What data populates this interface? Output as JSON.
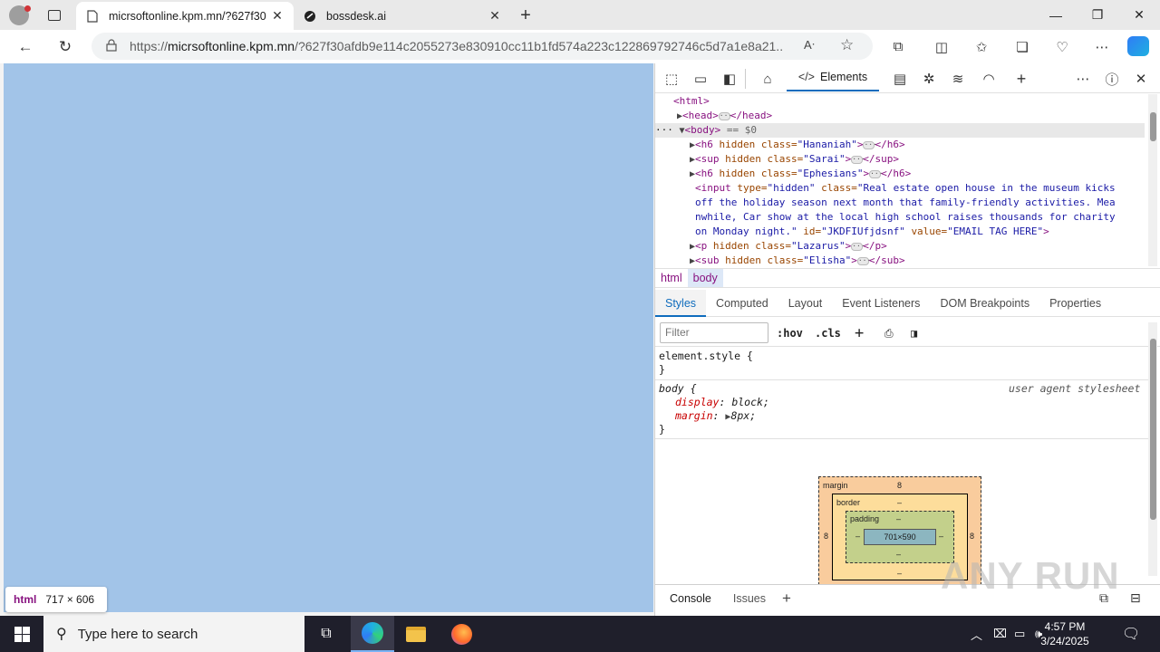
{
  "browser": {
    "tabs": [
      {
        "title": "micrsoftonline.kpm.mn/?627f30",
        "active": true
      },
      {
        "title": "bossdesk.ai",
        "active": false
      }
    ],
    "address": {
      "prefix": "https://",
      "host": "micrsoftonline.kpm.mn",
      "path": "/?627f30afdb9e114c2055273e830910cc11b1fd574a223c122869792746c5d7a1e8a21..."
    },
    "tooltip": {
      "tag": "html",
      "size": "717 × 606"
    }
  },
  "devtools": {
    "main_tab": "Elements",
    "dom_lines": {
      "html_open": "<html>",
      "head_tag": "<head>",
      "head_close": "</head>",
      "body_tag": "<body>",
      "body_eq": "== $0",
      "l1_tag": "<h6 ",
      "l1_attr": "hidden class=",
      "l1_val": "\"Hananiah\"",
      "l1_close": "</h6>",
      "l2_tag": "<sup ",
      "l2_attr": "hidden class=",
      "l2_val": "\"Sarai\"",
      "l2_close": "</sup>",
      "l3_tag": "<h6 ",
      "l3_attr": "hidden class=",
      "l3_val": "\"Ephesians\"",
      "l3_close": "</h6>",
      "input_tag": "<input ",
      "input_a1": "type=",
      "input_v1": "\"hidden\" ",
      "input_a2": "class=",
      "input_v2a": "\"Real estate open house in the museum kicks",
      "input_v2b": "off the holiday season next month that family-friendly activities. Mea",
      "input_v2c": "nwhile, Car show at the local high school raises thousands for charity",
      "input_v2d": "on Monday night.\" ",
      "input_a3": "id=",
      "input_v3": "\"JKDFIUfjdsnf\" ",
      "input_a4": "value=",
      "input_v4": "\"EMAIL TAG HERE\"",
      "input_end": ">",
      "l5_tag": "<p ",
      "l5_attr": "hidden class=",
      "l5_val": "\"Lazarus\"",
      "l5_close": "</p>",
      "l6_tag": "<sub ",
      "l6_attr": "hidden class=",
      "l6_val": "\"Elisha\"",
      "l6_close": "</sub>"
    },
    "breadcrumbs": [
      "html",
      "body"
    ],
    "sub_tabs": [
      "Styles",
      "Computed",
      "Layout",
      "Event Listeners",
      "DOM Breakpoints",
      "Properties"
    ],
    "filter_placeholder": "Filter",
    "hov": ":hov",
    "cls": ".cls",
    "styles": {
      "element_style": "element.style {",
      "close_brace": "}",
      "body_selector": "body {",
      "ua_label": "user agent stylesheet",
      "display_prop": "display",
      "display_val": "block;",
      "margin_prop": "margin",
      "margin_val": "8px;"
    },
    "box_model": {
      "margin_label": "margin",
      "margin_value": "8",
      "border_label": "border",
      "border_value": "–",
      "padding_label": "padding",
      "padding_value": "–",
      "content_size": "701×590",
      "side_margin": "8",
      "dash": "–"
    },
    "drawer_tabs": [
      "Console",
      "Issues"
    ]
  },
  "taskbar": {
    "search_placeholder": "Type here to search",
    "time": "4:57 PM",
    "date": "3/24/2025"
  },
  "watermark": "ANY RUN"
}
